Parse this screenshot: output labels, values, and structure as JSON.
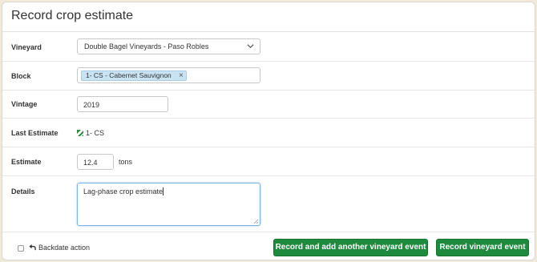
{
  "header": {
    "title": "Record crop estimate"
  },
  "form": {
    "vineyard": {
      "label": "Vineyard",
      "value": "Double Bagel Vineyards - Paso Robles"
    },
    "block": {
      "label": "Block",
      "tag": "1- CS - Cabernet Sauvignon",
      "remove": "×"
    },
    "vintage": {
      "label": "Vintage",
      "value": "2019"
    },
    "last_estimate": {
      "label": "Last Estimate",
      "value": "1- CS"
    },
    "estimate": {
      "label": "Estimate",
      "value": "12.4",
      "unit": "tons"
    },
    "details": {
      "label": "Details",
      "value": "Lag-phase crop estimate"
    }
  },
  "footer": {
    "backdate_label": "Backdate action",
    "record_another_label": "Record and add another vineyard event",
    "record_label": "Record vineyard event"
  },
  "colors": {
    "primary_button": "#1d8a3e",
    "tag_bg": "#c9e3f2",
    "page_bg": "#f2ead9"
  },
  "icons": [
    "chevron-down-icon",
    "close-icon",
    "flag-icon",
    "undo-arrow-icon"
  ]
}
